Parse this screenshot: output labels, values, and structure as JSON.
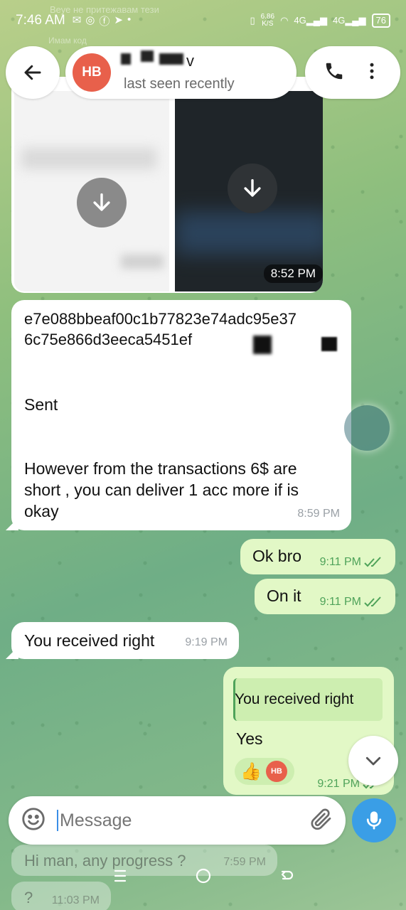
{
  "status_bar": {
    "time": "7:46 AM",
    "net_speed_value": "6.86",
    "net_speed_unit": "K/S",
    "network1": "4G",
    "network2": "4G",
    "battery": "76",
    "notif_bg_1": "Веуе не притежавам тези",
    "notif_bg_2": "Имам код"
  },
  "header": {
    "avatar_initials": "HB",
    "contact_name_suffix": "v",
    "last_seen": "last seen recently"
  },
  "media": {
    "time": "8:52 PM"
  },
  "messages": {
    "hash_line1": "e7e088bbeaf00c1b77823e74adc95e37",
    "hash_line2": "6c75e866d3eeca5451ef",
    "sent": "Sent",
    "body": "However from the transactions 6$ are short , you can deliver 1 acc more if is okay",
    "msg1_time": "8:59 PM",
    "okbro": "Ok bro",
    "okbro_time": "9:11 PM",
    "onit": "On it",
    "onit_time": "9:11 PM",
    "received": "You received right",
    "received_time": "9:19 PM",
    "quote_text": "You received right",
    "yes": "Yes",
    "reaction_emoji": "👍",
    "reaction_avatar": "HB",
    "yes_time": "9:21 PM"
  },
  "composer": {
    "placeholder": "Message"
  },
  "ghost": {
    "msg1": "Hi man, any progress ?",
    "msg1_time": "7:59 PM",
    "msg2": "?",
    "msg2_time": "11:03 PM"
  },
  "icons": {
    "back": "arrow-left-icon",
    "call": "phone-icon",
    "menu": "more-vertical-icon",
    "download": "download-icon",
    "emoji": "smiley-icon",
    "attach": "paperclip-icon",
    "mic": "microphone-icon",
    "scroll": "chevron-down-icon"
  },
  "colors": {
    "accent": "#3a9ee6",
    "outgoing": "#e2f8c6",
    "check": "#4fa35a",
    "avatar": "#e8604b"
  }
}
